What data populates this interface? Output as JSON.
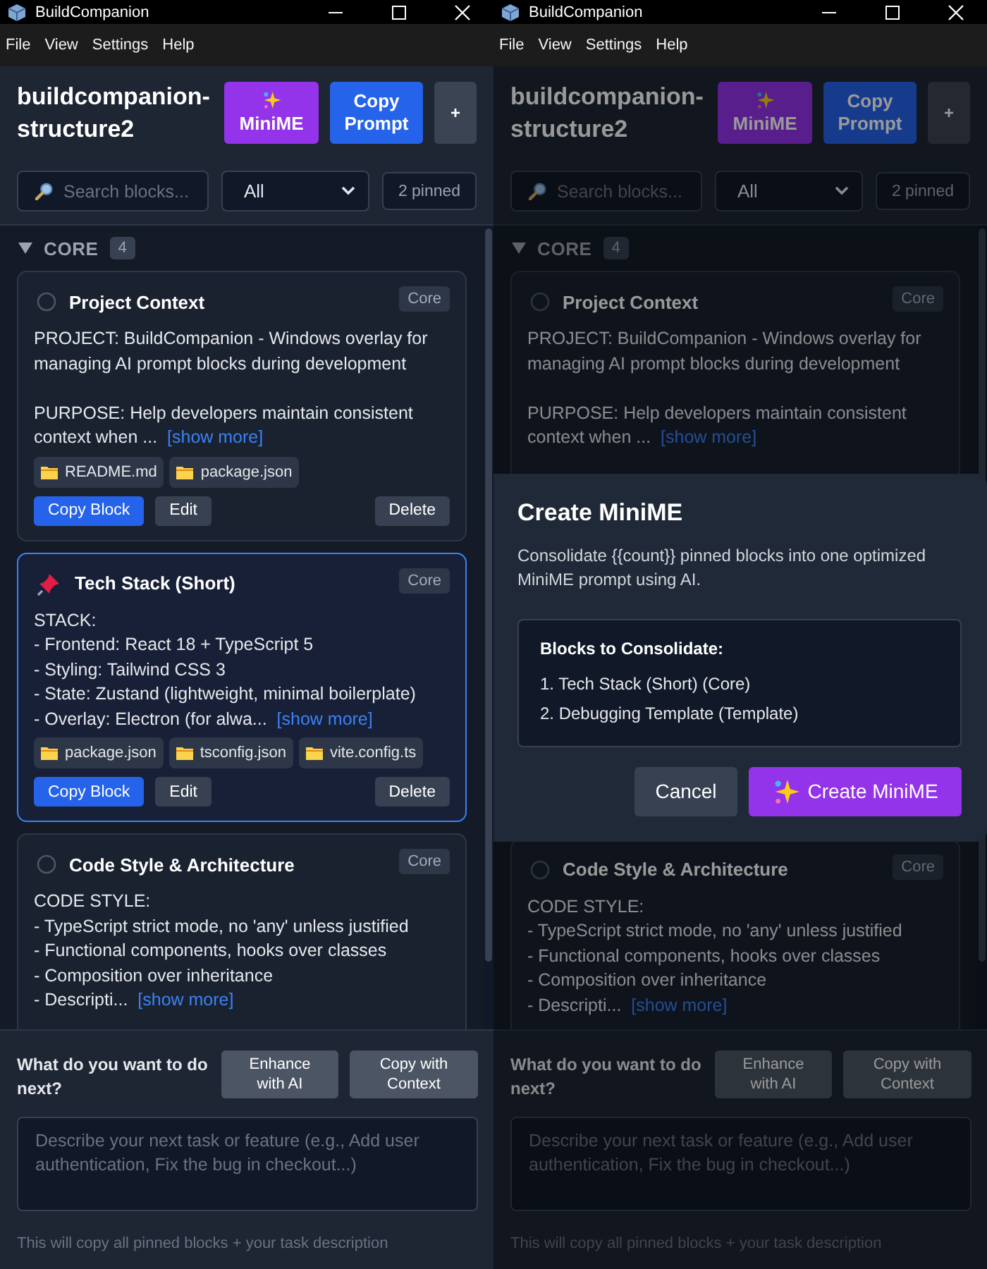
{
  "windows": [
    {
      "title": "BuildCompanion",
      "menu": [
        "File",
        "View",
        "Settings",
        "Help"
      ],
      "project": "buildcompanion-structure2",
      "header_buttons": [
        {
          "kind": "minime",
          "label": "MiniME"
        },
        {
          "kind": "copy",
          "label": "Copy Prompt"
        },
        {
          "kind": "add",
          "label": "+"
        }
      ],
      "search": {
        "placeholder": "Search blocks..."
      },
      "filter": "All",
      "pinned_count": "2 pinned",
      "sections": [
        {
          "name": "CORE",
          "count": "4",
          "expanded": true,
          "blocks": [
            {
              "title": "Project Context",
              "pinned": false,
              "tag": "Core",
              "paragraphs": [
                [
                  "PROJECT: BuildCompanion - Windows overlay for managing AI prompt blocks during development"
                ],
                [
                  "PURPOSE: Help developers maintain consistent context when ..."
                ]
              ],
              "show_more": "[show more]",
              "files": [
                "README.md",
                "package.json"
              ],
              "actions": [
                {
                  "kind": "copy",
                  "label": "Copy Block"
                },
                {
                  "kind": "edit",
                  "label": "Edit"
                },
                {
                  "kind": "delete",
                  "label": "Delete"
                }
              ]
            },
            {
              "title": "Tech Stack (Short)",
              "pinned": true,
              "tag": "Core",
              "paragraphs": [
                [
                  "STACK:",
                  "- Frontend: React 18 + TypeScript 5",
                  "- Styling: Tailwind CSS 3",
                  "- State: Zustand (lightweight, minimal boilerplate)",
                  "- Overlay: Electron (for alwa..."
                ]
              ],
              "show_more": "[show more]",
              "files": [
                "package.json",
                "tsconfig.json",
                "vite.config.ts"
              ],
              "actions": [
                {
                  "kind": "copy",
                  "label": "Copy Block"
                },
                {
                  "kind": "edit",
                  "label": "Edit"
                },
                {
                  "kind": "delete",
                  "label": "Delete"
                }
              ]
            },
            {
              "title": "Code Style & Architecture",
              "pinned": false,
              "tag": "Core",
              "paragraphs": [
                [
                  "CODE STYLE:",
                  "- TypeScript strict mode, no 'any' unless justified",
                  "- Functional components, hooks over classes",
                  "- Composition over inheritance",
                  "- Descripti..."
                ]
              ],
              "show_more": "[show more]"
            }
          ]
        }
      ],
      "next_panel": {
        "question": "What do you want to do next?",
        "buttons": [
          "Enhance with AI",
          "Copy with Context"
        ],
        "placeholder": "Describe your next task or feature (e.g., Add user authentication, Fix the bug in checkout...)",
        "hint": "This will copy all pinned blocks + your task description"
      }
    },
    {
      "title": "BuildCompanion",
      "menu": [
        "File",
        "View",
        "Settings",
        "Help"
      ],
      "project": "buildcompanion-structure2",
      "header_buttons": [
        {
          "kind": "minime",
          "label": "MiniME"
        },
        {
          "kind": "copy",
          "label": "Copy Prompt"
        },
        {
          "kind": "add",
          "label": "+"
        }
      ],
      "search": {
        "placeholder": "Search blocks..."
      },
      "filter": "All",
      "pinned_count": "2 pinned",
      "sections": [
        {
          "name": "CORE",
          "count": "4",
          "expanded": true,
          "blocks": [
            {
              "title": "Project Context",
              "pinned": false,
              "tag": "Core",
              "paragraphs": [
                [
                  "PROJECT: BuildCompanion - Windows overlay for managing AI prompt blocks during development"
                ],
                [
                  "PURPOSE: Help developers maintain consistent context when ..."
                ]
              ],
              "show_more": "[show more]"
            },
            {
              "title": "Code Style & Architecture",
              "pinned": false,
              "tag": "Core",
              "paragraphs": [
                [
                  "CODE STYLE:",
                  "- TypeScript strict mode, no 'any' unless justified",
                  "- Functional components, hooks over classes",
                  "- Composition over inheritance",
                  "- Descripti..."
                ]
              ],
              "show_more": "[show more]"
            }
          ]
        }
      ],
      "next_panel": {
        "question": "What do you want to do next?",
        "buttons": [
          "Enhance with AI",
          "Copy with Context"
        ],
        "placeholder": "Describe your next task or feature (e.g., Add user authentication, Fix the bug in checkout...)",
        "hint": "This will copy all pinned blocks + your task description"
      },
      "dialog": {
        "title": "Create MiniME",
        "description": "Consolidate {{count}} pinned blocks into one optimized MiniME prompt using AI.",
        "list_title": "Blocks to Consolidate:",
        "items": [
          "1. Tech Stack (Short) (Core)",
          "2. Debugging Template (Template)"
        ],
        "buttons": [
          {
            "kind": "cancel",
            "label": "Cancel"
          },
          {
            "kind": "create",
            "label": "Create MiniME"
          }
        ]
      }
    }
  ]
}
